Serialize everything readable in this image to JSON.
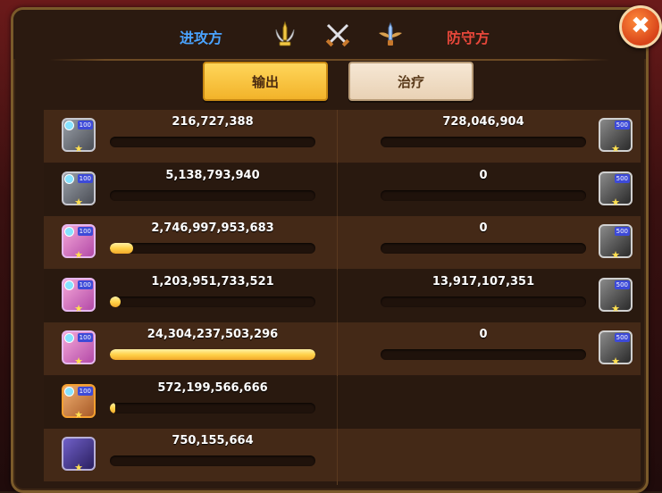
{
  "header": {
    "attacker_label": "进攻方",
    "defender_label": "防守方",
    "icons": [
      "trophy-sword-icon",
      "crossed-swords-icon",
      "winged-sword-icon"
    ]
  },
  "tabs": [
    {
      "label": "输出",
      "active": true
    },
    {
      "label": "治疗",
      "active": false
    }
  ],
  "close_icon": "✖",
  "colors": {
    "attacker": "#4aa3ff",
    "defender": "#e8473a",
    "active_tab": "#f2b32a",
    "bar_fill": "#ffd24a"
  },
  "rows": [
    {
      "attacker": {
        "avatar": "gray",
        "level": "100",
        "value": "216,727,388",
        "fill": 0.0
      },
      "defender": {
        "avatar": "dark",
        "level": "500",
        "value": "728,046,904",
        "fill": 0.0
      }
    },
    {
      "attacker": {
        "avatar": "gray",
        "level": "100",
        "value": "5,138,793,940",
        "fill": 0.0
      },
      "defender": {
        "avatar": "dark",
        "level": "500",
        "value": "0",
        "fill": 0.0
      }
    },
    {
      "attacker": {
        "avatar": "pink",
        "level": "100",
        "value": "2,746,997,953,683",
        "fill": 0.113
      },
      "defender": {
        "avatar": "dark",
        "level": "500",
        "value": "0",
        "fill": 0.0
      }
    },
    {
      "attacker": {
        "avatar": "pink",
        "level": "100",
        "value": "1,203,951,733,521",
        "fill": 0.05
      },
      "defender": {
        "avatar": "dark",
        "level": "500",
        "value": "13,917,107,351",
        "fill": 0.0
      }
    },
    {
      "attacker": {
        "avatar": "pink",
        "level": "100",
        "value": "24,304,237,503,296",
        "fill": 1.0
      },
      "defender": {
        "avatar": "dark",
        "level": "500",
        "value": "0",
        "fill": 0.0
      }
    },
    {
      "attacker": {
        "avatar": "orange",
        "level": "100",
        "value": "572,199,566,666",
        "fill": 0.024
      },
      "defender": null
    },
    {
      "attacker": {
        "avatar": "purple",
        "level": "",
        "value": "750,155,664",
        "fill": 0.0
      },
      "defender": null
    }
  ]
}
